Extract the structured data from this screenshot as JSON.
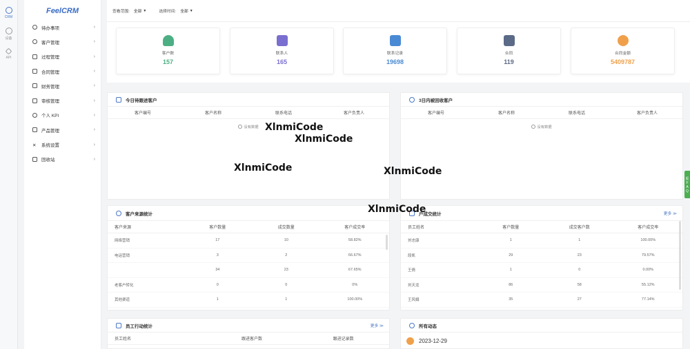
{
  "rail": [
    {
      "label": "CRM",
      "icon": "crm-icon",
      "active": true
    },
    {
      "label": "设备",
      "icon": "device-icon"
    },
    {
      "label": "API",
      "icon": "api-icon"
    }
  ],
  "app": {
    "logo": "FeelCRM"
  },
  "menu": [
    {
      "label": "待办事项"
    },
    {
      "label": "客户管理"
    },
    {
      "label": "过程管理"
    },
    {
      "label": "合同管理"
    },
    {
      "label": "财务管理"
    },
    {
      "label": "审核管理"
    },
    {
      "label": "个人 KPI"
    },
    {
      "label": "产品管理"
    },
    {
      "label": "系统设置"
    },
    {
      "label": "回收站"
    }
  ],
  "filters": {
    "scope_label": "查看范围:",
    "scope_value": "全部",
    "time_label": "选择时间:",
    "time_value": "全部"
  },
  "stats": [
    {
      "label": "客户数",
      "value": "157",
      "color": "#4caf83"
    },
    {
      "label": "联系人",
      "value": "165",
      "color": "#7a6fd0"
    },
    {
      "label": "联系记录",
      "value": "19698",
      "color": "#4a8ad4"
    },
    {
      "label": "合同",
      "value": "119",
      "color": "#5b6a86"
    },
    {
      "label": "合同金额",
      "value": "5409787",
      "color": "#f0a04b"
    }
  ],
  "followup": {
    "title": "今日待跟进客户",
    "columns": [
      "客户编号",
      "客户名称",
      "联系电话",
      "客户负责人"
    ],
    "empty": "没有数据"
  },
  "recycle": {
    "title": "3日内被回收客户",
    "columns": [
      "客户编号",
      "客户名称",
      "联系电话",
      "客户负责人"
    ],
    "empty": "没有数据"
  },
  "source_stats": {
    "title": "客户来源统计",
    "columns": [
      "客户来源",
      "客户数量",
      "成交数量",
      "客户成交率"
    ],
    "rows": [
      [
        "网络营销",
        "17",
        "10",
        "58.82%"
      ],
      [
        "电话营销",
        "3",
        "2",
        "66.67%"
      ],
      [
        "",
        "34",
        "23",
        "67.65%"
      ],
      [
        "老客户转化",
        "0",
        "0",
        "0%"
      ],
      [
        "其他渠道",
        "1",
        "1",
        "100.00%"
      ]
    ]
  },
  "deal_stats": {
    "title": "户成交统计",
    "more": "更多 ≫",
    "columns": [
      "员工姓名",
      "客户数量",
      "成交客户数",
      "客户成交率"
    ],
    "rows": [
      [
        "刘志康",
        "1",
        "1",
        "100.00%"
      ],
      [
        "段凯",
        "29",
        "23",
        "79.57%"
      ],
      [
        "王倩",
        "1",
        "0",
        "0.00%"
      ],
      [
        "刘天龙",
        "86",
        "58",
        "55.12%"
      ],
      [
        "王风娟",
        "35",
        "27",
        "77.14%"
      ]
    ]
  },
  "staff_stats": {
    "title": "员工行动统计",
    "more": "更多 ≫",
    "columns": [
      "员工姓名",
      "跟进客户数",
      "跟进记录数"
    ]
  },
  "activity": {
    "title": "所有动态",
    "date": "2023-12-29"
  },
  "faq": [
    "反",
    "F",
    "A",
    "Q"
  ],
  "watermarks": [
    "XlnmiCode",
    "XlnmiCode",
    "XlnmiCode",
    "XlnmiCode",
    "XlnmiCode"
  ]
}
